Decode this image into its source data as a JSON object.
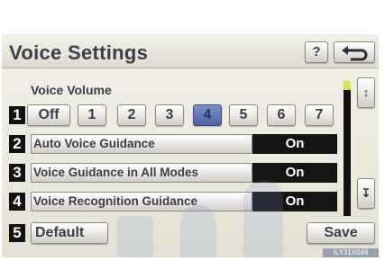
{
  "header": {
    "title": "Voice Settings",
    "help_label": "?",
    "back_icon": "return-arrow-icon"
  },
  "voice_volume": {
    "label": "Voice Volume",
    "index": "1",
    "options": [
      "Off",
      "1",
      "2",
      "3",
      "4",
      "5",
      "6",
      "7"
    ],
    "selected": "4"
  },
  "settings": [
    {
      "index": "2",
      "label": "Auto Voice Guidance",
      "value": "On"
    },
    {
      "index": "3",
      "label": "Voice Guidance in All Modes",
      "value": "On"
    },
    {
      "index": "4",
      "label": "Voice Recognition Guidance",
      "value": "On"
    }
  ],
  "footer": {
    "default_index": "5",
    "default_label": "Default",
    "save_label": "Save"
  },
  "scroll": {
    "up_icon": "scroll-up-arrow-icon",
    "down_icon": "scroll-down-arrow-icon",
    "position": 0.0
  },
  "watermark": "ILY31X046",
  "colors": {
    "selected_volume": "#5a6fb0",
    "state_background": "#141414",
    "scroll_thumb": "#d8e04a"
  }
}
